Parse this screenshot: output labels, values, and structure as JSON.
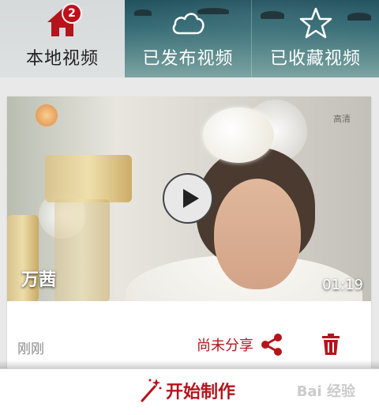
{
  "tabs": [
    {
      "label": "本地视频",
      "icon": "home-icon",
      "badge": "2",
      "active": true
    },
    {
      "label": "已发布视频",
      "icon": "cloud-icon",
      "active": false
    },
    {
      "label": "已收藏视频",
      "icon": "star-icon",
      "active": false
    }
  ],
  "video": {
    "title": "万茜",
    "duration": "01:19",
    "quality_mark": "高清",
    "time": "刚刚",
    "share_label": "尚未分享"
  },
  "bottom": {
    "start_label": "开始制作",
    "watermark": "Bai 经验"
  },
  "colors": {
    "accent": "#b5141c",
    "badge": "#c0101c"
  }
}
